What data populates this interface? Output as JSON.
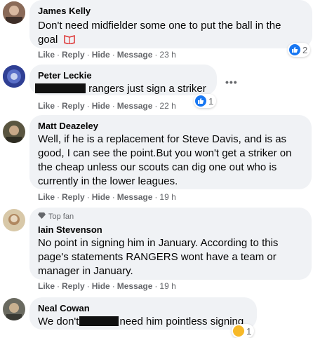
{
  "actions": {
    "like": "Like",
    "reply": "Reply",
    "hide": "Hide",
    "message": "Message",
    "sep": "·"
  },
  "comments": [
    {
      "author": "James Kelly",
      "text_line1": "Don't need midfielder some one to put the ball in the",
      "text_line2": "goal",
      "time": "23 h",
      "reaction_count": "2"
    },
    {
      "author": "Peter Leckie",
      "text": "rangers just sign a striker",
      "time": "22 h",
      "reaction_count": "1",
      "more_label": "•••"
    },
    {
      "author": "Matt Deazeley",
      "text_lines": [
        "Well, if he is a replacement for Steve Davis, and is as",
        "good, I can see the point.But you won't get a striker on",
        "the cheap unless our scouts can dig one out who is",
        "currently in the lower leagues."
      ],
      "time": "19 h"
    },
    {
      "badge": "Top fan",
      "author": "Iain Stevenson",
      "text_lines": [
        "No point in signing him in January. According to this",
        "page's statements RANGERS wont have a team or",
        "manager in January."
      ],
      "time": "19 h"
    },
    {
      "author": "Neal Cowan",
      "text_before": "We don't",
      "text_after": "need him pointless signing",
      "reaction_count": "1"
    }
  ],
  "colors": {
    "bubble": "#f0f2f5",
    "meta": "#65676b",
    "like_blue": "#1877f2"
  }
}
